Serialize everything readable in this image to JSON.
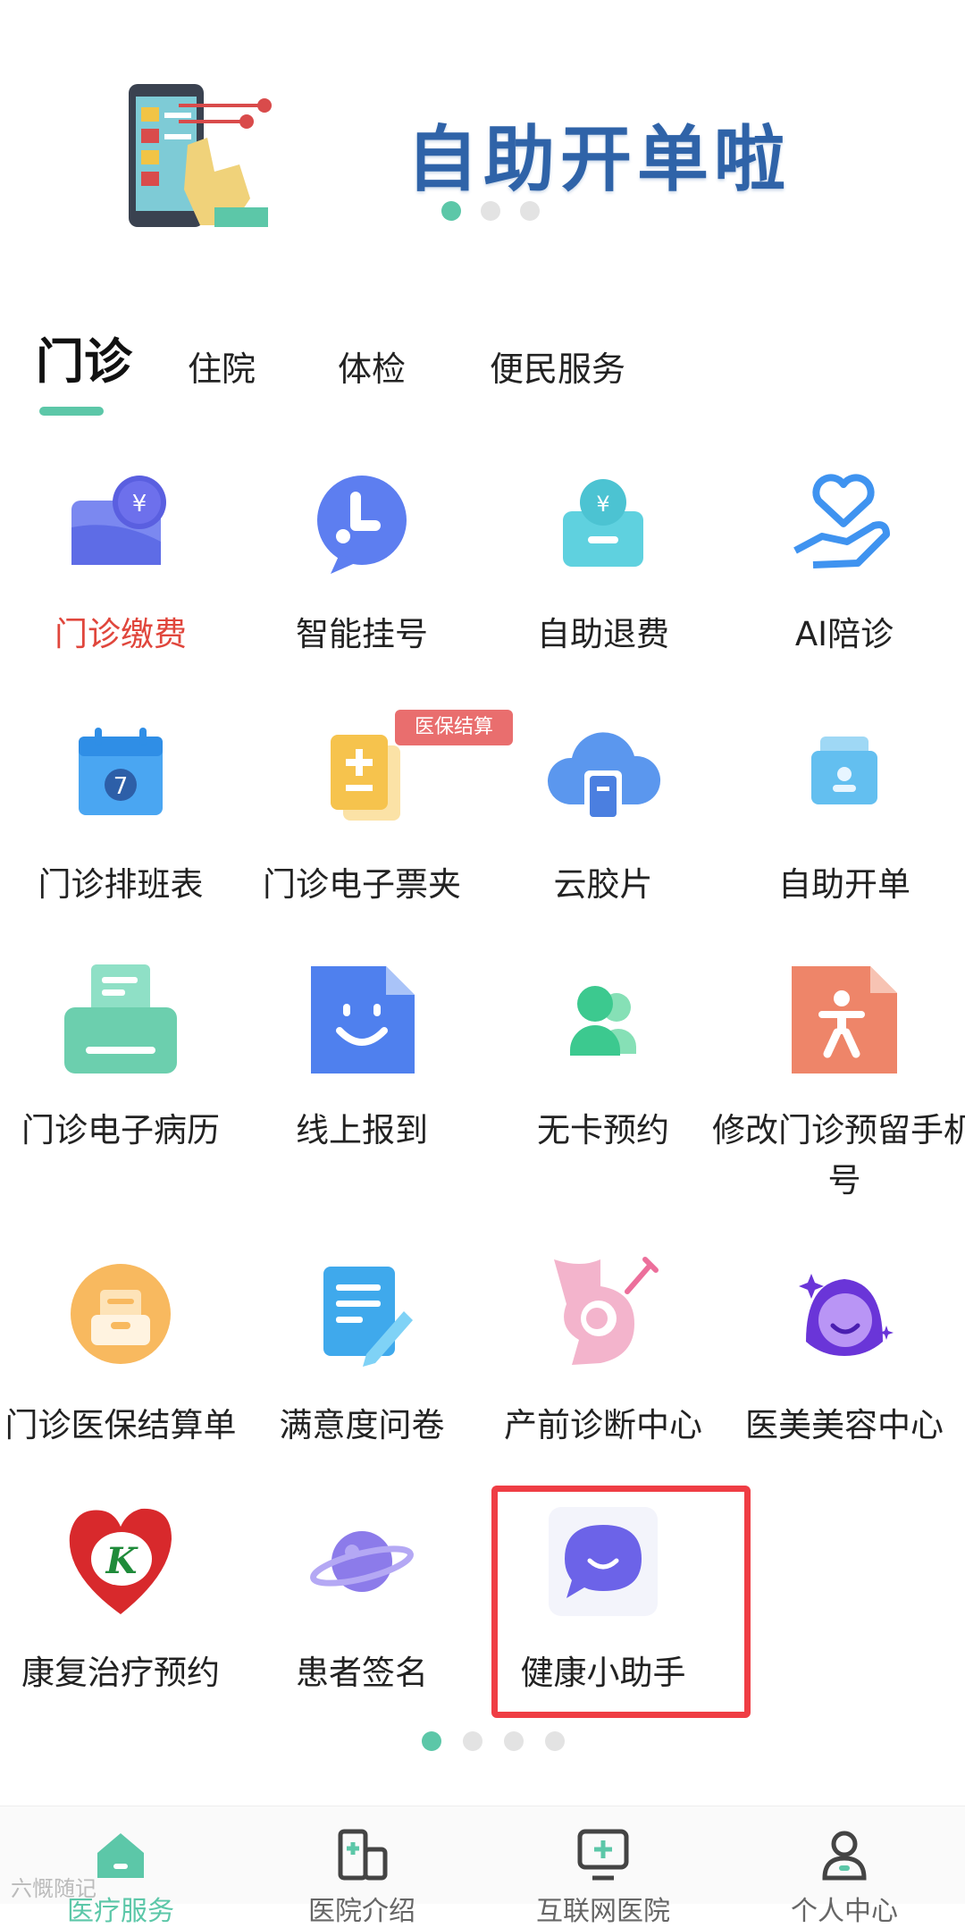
{
  "banner": {
    "title": "自助开单啦",
    "carousel_dots": 3,
    "active_dot": 0
  },
  "tabs": [
    {
      "label": "门诊",
      "active": true
    },
    {
      "label": "住院",
      "active": false
    },
    {
      "label": "体检",
      "active": false
    },
    {
      "label": "便民服务",
      "active": false
    }
  ],
  "services": [
    {
      "label": "门诊缴费",
      "icon": "payment-wallet-icon",
      "highlighted_text": true
    },
    {
      "label": "智能挂号",
      "icon": "smart-registration-icon"
    },
    {
      "label": "自助退费",
      "icon": "refund-box-icon"
    },
    {
      "label": "AI陪诊",
      "icon": "care-hand-heart-icon"
    },
    {
      "label": "门诊排班表",
      "icon": "calendar-icon"
    },
    {
      "label": "门诊电子票夹",
      "icon": "e-ticket-folder-icon",
      "badge": "医保结算"
    },
    {
      "label": "云胶片",
      "icon": "cloud-film-icon"
    },
    {
      "label": "自助开单",
      "icon": "self-order-icon"
    },
    {
      "label": "门诊电子病历",
      "icon": "printer-record-icon"
    },
    {
      "label": "线上报到",
      "icon": "online-checkin-icon"
    },
    {
      "label": "无卡预约",
      "icon": "no-card-booking-icon"
    },
    {
      "label": "修改门诊预留手机号",
      "icon": "modify-phone-icon"
    },
    {
      "label": "门诊医保结算单",
      "icon": "insurance-statement-icon"
    },
    {
      "label": "满意度问卷",
      "icon": "survey-icon"
    },
    {
      "label": "产前诊断中心",
      "icon": "prenatal-center-icon"
    },
    {
      "label": "医美美容中心",
      "icon": "beauty-center-icon"
    },
    {
      "label": "康复治疗预约",
      "icon": "rehab-logo-icon"
    },
    {
      "label": "患者签名",
      "icon": "signature-planet-icon"
    },
    {
      "label": "健康小助手",
      "icon": "health-assistant-chat-icon",
      "selected": true
    }
  ],
  "grid_pages": 4,
  "active_grid_page": 0,
  "bottom_nav": [
    {
      "label": "医疗服务",
      "icon": "home-icon",
      "active": true
    },
    {
      "label": "医院介绍",
      "icon": "hospital-building-icon",
      "active": false
    },
    {
      "label": "互联网医院",
      "icon": "online-hospital-icon",
      "active": false
    },
    {
      "label": "个人中心",
      "icon": "user-profile-icon",
      "active": false
    }
  ],
  "watermark": "六慨随记",
  "colors": {
    "accent": "#5cc7a8",
    "highlight_text": "#e0463c",
    "badge": "#e96e6e",
    "selection_border": "#ef3d44",
    "banner_title": "#2f63a8"
  }
}
